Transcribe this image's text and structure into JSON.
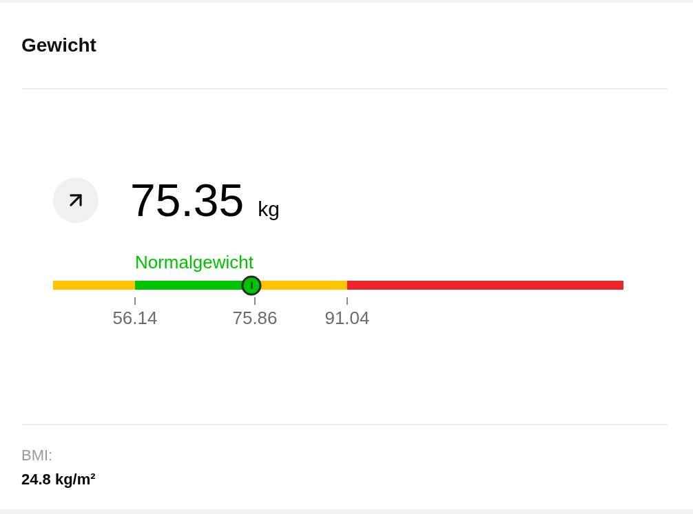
{
  "card": {
    "title": "Gewicht",
    "weight": {
      "value": "75.35",
      "unit": "kg"
    },
    "scale": {
      "segments": [
        {
          "color": "#ffc400",
          "limit": "56.14"
        },
        {
          "color": "#00c300",
          "label": "Normalgewicht",
          "limit": "75.86"
        },
        {
          "color": "#ffc400",
          "limit": "91.04"
        },
        {
          "color": "#ee2329"
        }
      ],
      "marker": {
        "level": 0.348
      }
    },
    "bmi": {
      "label": "BMI:",
      "value": "24.8 kg/m²"
    }
  }
}
